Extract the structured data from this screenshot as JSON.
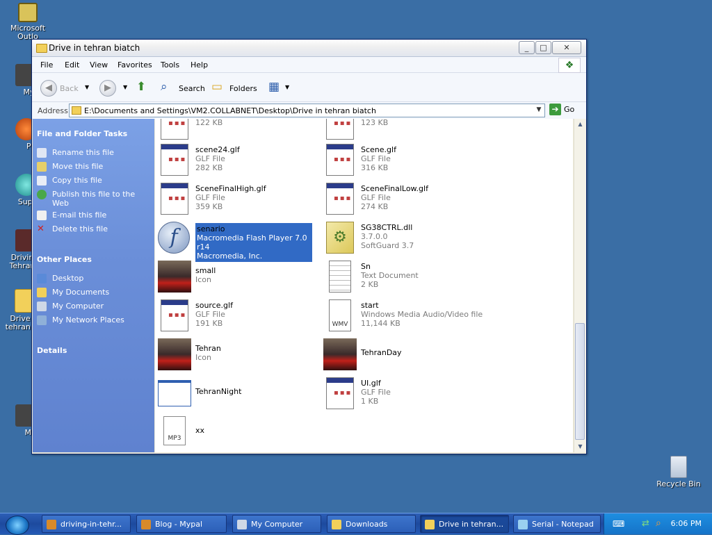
{
  "desktop": {
    "icons": [
      {
        "label": "Microsoft Outlo",
        "icon": "outlook-icon"
      },
      {
        "label": "MyPa",
        "icon": "app-icon"
      },
      {
        "label": "Peg",
        "icon": "app-icon"
      },
      {
        "label": "Superr",
        "icon": "shortcut-icon"
      },
      {
        "label": "Drivin Tehran",
        "icon": "game-icon"
      },
      {
        "label": "Drive tehran i",
        "icon": "folder-icon"
      },
      {
        "label": "Myp",
        "icon": "game-icon"
      }
    ],
    "recycle_bin": "Recycle Bin"
  },
  "window": {
    "title": "Drive in tehran biatch",
    "menu": [
      "File",
      "Edit",
      "View",
      "Favorites",
      "Tools",
      "Help"
    ],
    "toolbar": {
      "back": "Back",
      "search": "Search",
      "folders": "Folders"
    },
    "address": {
      "label": "Address",
      "path": "E:\\Documents and Settings\\VM2.COLLABNET\\Desktop\\Drive in tehran biatch",
      "go": "Go"
    }
  },
  "tasks": {
    "file_folder_tasks_title": "File and Folder Tasks",
    "items": [
      "Rename this file",
      "Move this file",
      "Copy this file",
      "Publish this file to the Web",
      "E-mail this file",
      "Delete this file"
    ],
    "other_places_title": "Other Places",
    "places": [
      "Desktop",
      "My Documents",
      "My Computer",
      "My Network Places"
    ],
    "details_title": "Details"
  },
  "files": {
    "left": [
      {
        "name": "",
        "type": "GLF File",
        "size": "122 KB",
        "icon": "glf-file-icon"
      },
      {
        "name": "scene24.glf",
        "type": "GLF File",
        "size": "282 KB",
        "icon": "glf-file-icon"
      },
      {
        "name": "SceneFinalHigh.glf",
        "type": "GLF File",
        "size": "359 KB",
        "icon": "glf-file-icon"
      },
      {
        "name": "senario",
        "type": "Macromedia Flash Player 7.0  r14",
        "size": "Macromedia, Inc.",
        "icon": "flash-icon",
        "selected": true
      },
      {
        "name": "small",
        "type": "Icon",
        "size": "",
        "icon": "car-icon"
      },
      {
        "name": "source.glf",
        "type": "GLF File",
        "size": "191 KB",
        "icon": "glf-file-icon"
      },
      {
        "name": "Tehran",
        "type": "Icon",
        "size": "",
        "icon": "car-icon"
      },
      {
        "name": "TehranNight",
        "type": "",
        "size": "",
        "icon": "window-icon"
      },
      {
        "name": "xx",
        "type": "",
        "size": "",
        "icon": "mp3-icon"
      }
    ],
    "right": [
      {
        "name": "",
        "type": "GLF File",
        "size": "123 KB",
        "icon": "glf-file-icon"
      },
      {
        "name": "Scene.glf",
        "type": "GLF File",
        "size": "316 KB",
        "icon": "glf-file-icon"
      },
      {
        "name": "SceneFinalLow.glf",
        "type": "GLF File",
        "size": "274 KB",
        "icon": "glf-file-icon"
      },
      {
        "name": "SG38CTRL.dll",
        "type": "3.7.0.0",
        "size": "SoftGuard 3.7",
        "icon": "dll-icon"
      },
      {
        "name": "Sn",
        "type": "Text Document",
        "size": "2 KB",
        "icon": "text-document-icon"
      },
      {
        "name": "start",
        "type": "Windows Media Audio/Video file",
        "size": "11,144 KB",
        "icon": "wmv-icon"
      },
      {
        "name": "TehranDay",
        "type": "",
        "size": "",
        "icon": "car-icon"
      },
      {
        "name": "UI.glf",
        "type": "GLF File",
        "size": "1 KB",
        "icon": "glf-file-icon"
      }
    ]
  },
  "taskbar": {
    "tasks": [
      {
        "label": "driving-in-tehr...",
        "icon": "browser-icon"
      },
      {
        "label": "Blog - Mypal",
        "icon": "browser-icon"
      },
      {
        "label": "My Computer",
        "icon": "computer-icon"
      },
      {
        "label": "Downloads",
        "icon": "folder-icon"
      },
      {
        "label": "Drive in tehran...",
        "icon": "folder-icon",
        "active": true
      },
      {
        "label": "Serial - Notepad",
        "icon": "notepad-icon"
      }
    ],
    "clock": "6:06 PM"
  }
}
